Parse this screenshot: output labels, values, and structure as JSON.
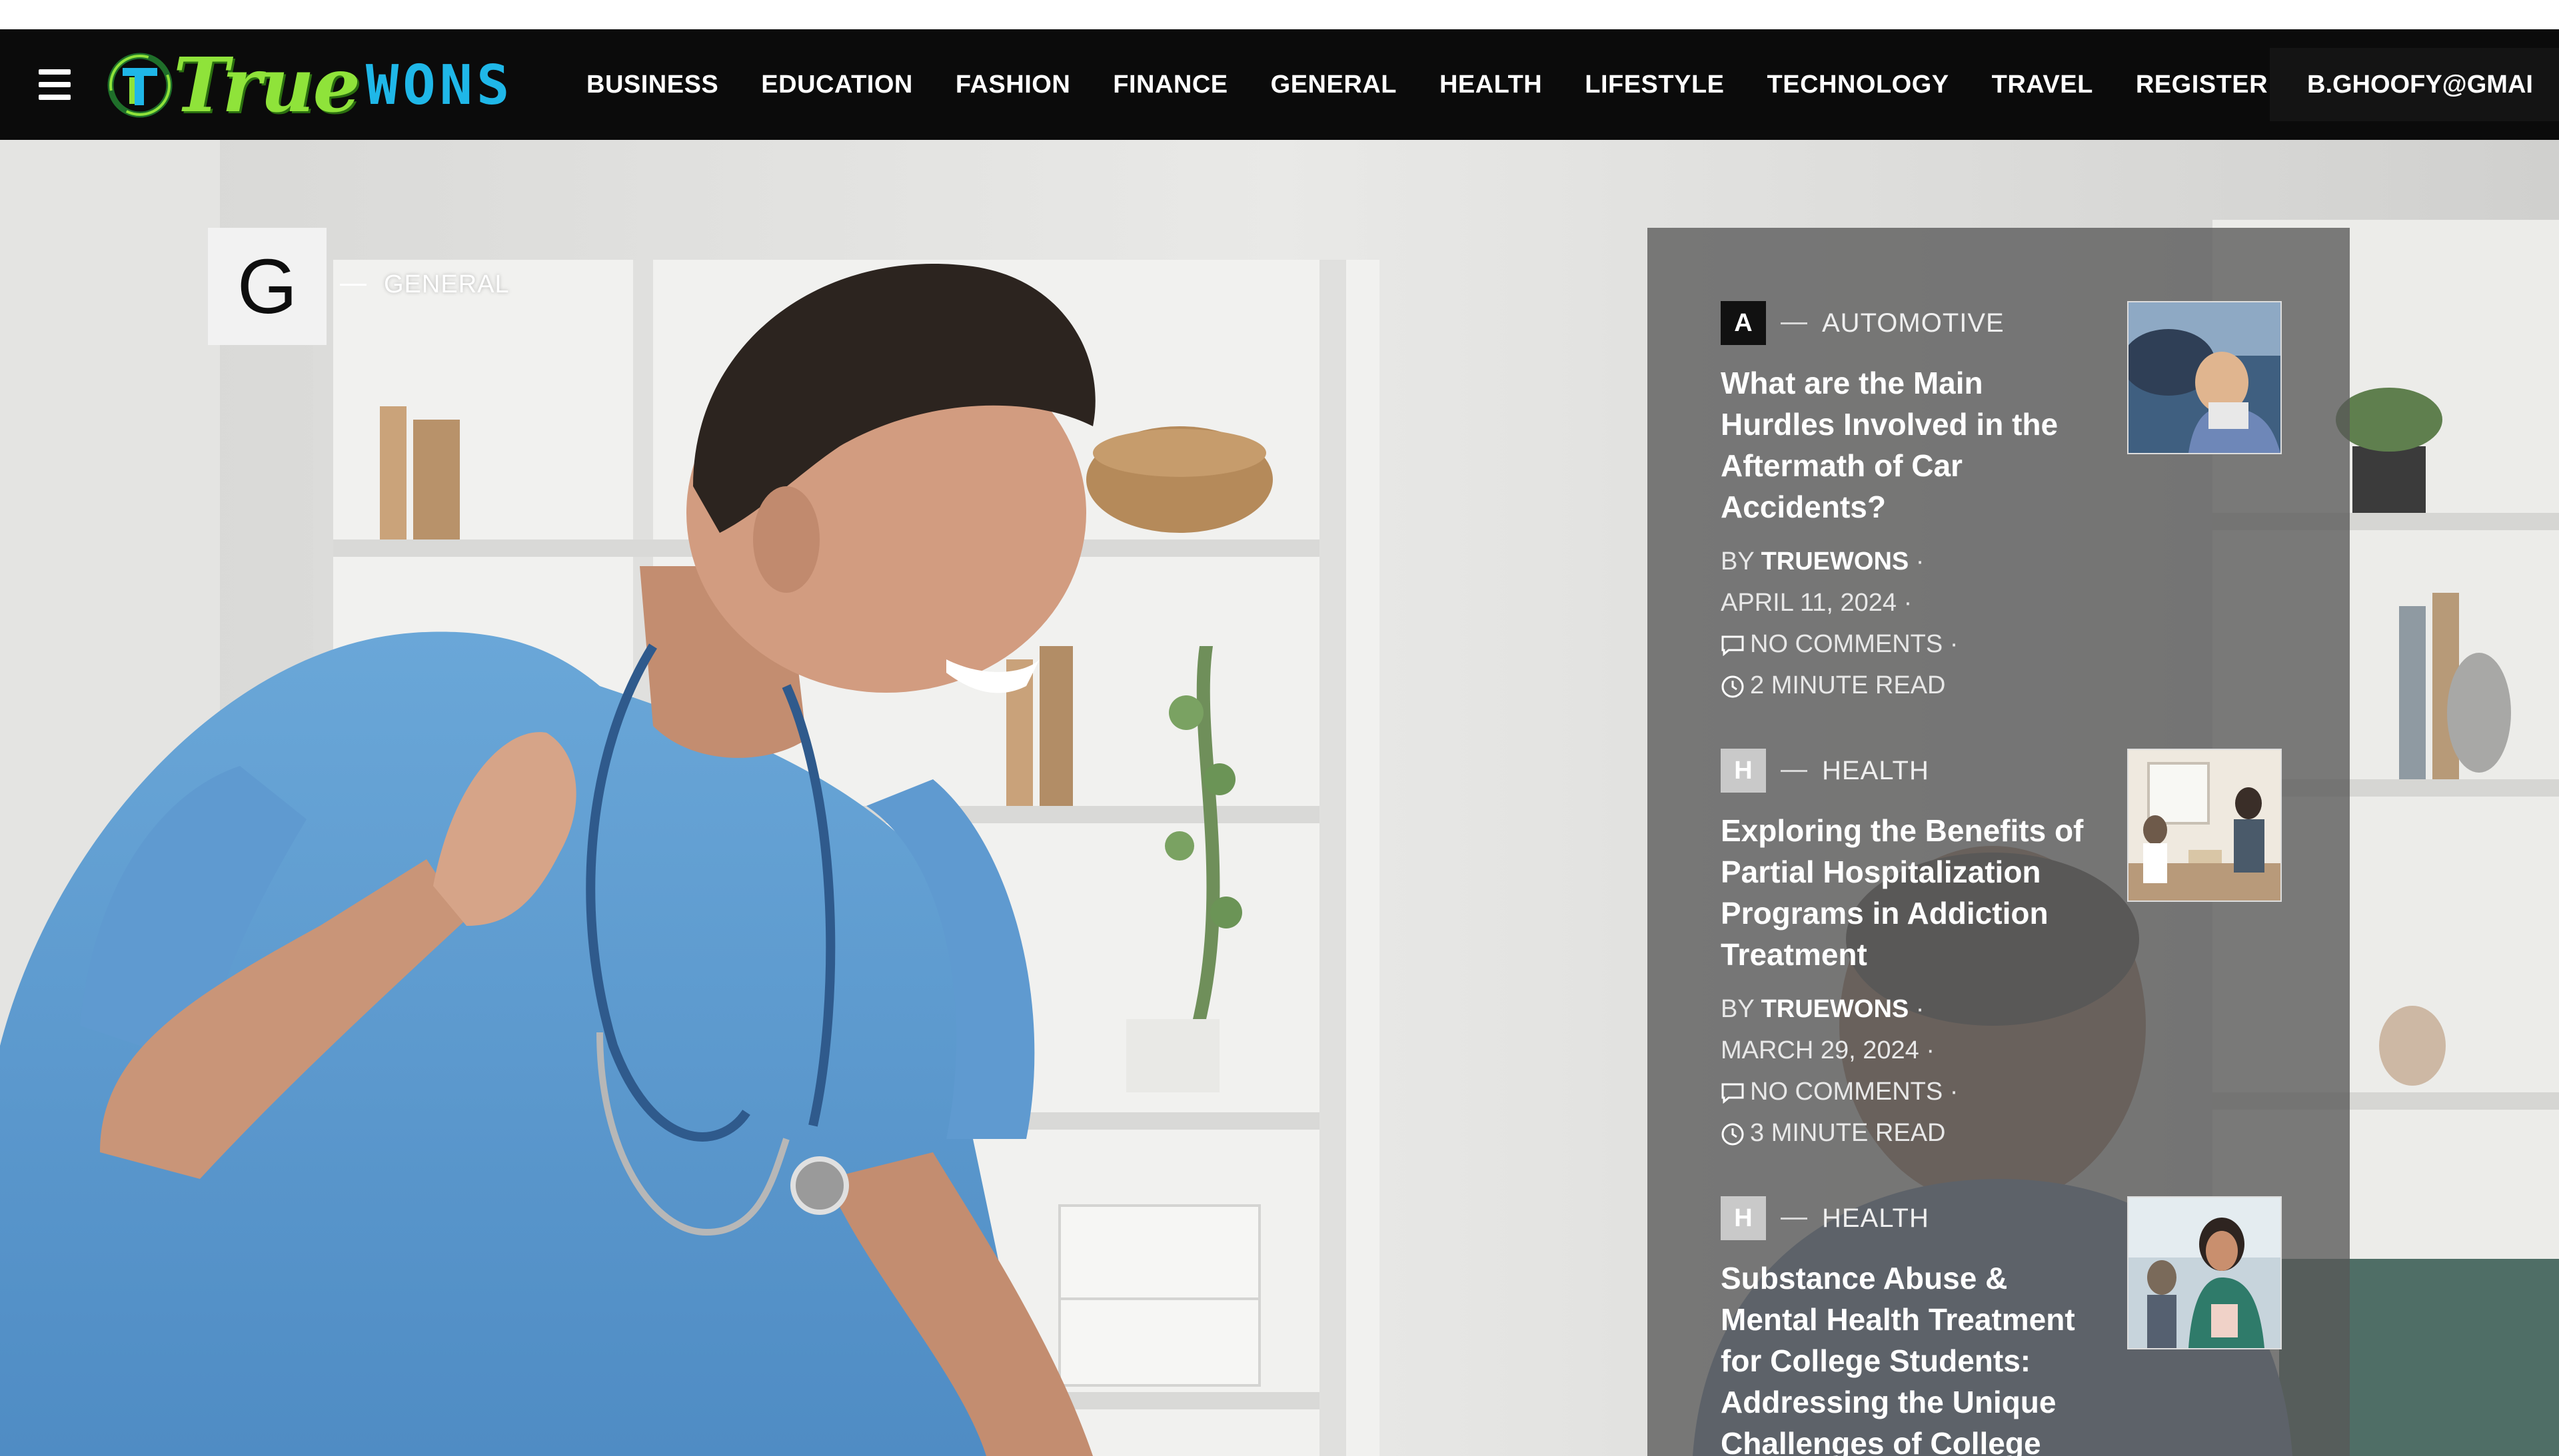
{
  "header": {
    "logo_true": "True",
    "logo_wons": "WONS",
    "nav": [
      "BUSINESS",
      "EDUCATION",
      "FASHION",
      "FINANCE",
      "GENERAL",
      "HEALTH",
      "LIFESTYLE",
      "TECHNOLOGY",
      "TRAVEL",
      "REGISTER"
    ],
    "account_email": "B.GHOOFY@GMAI",
    "icons": {
      "menu": "hamburger-menu-icon",
      "logo": "truewons-logo-icon"
    },
    "colors": {
      "background": "#0b0b0b",
      "logo_green": "#8fe33a",
      "logo_blue": "#1fb7e8"
    }
  },
  "hero": {
    "category_letter": "G",
    "category_name": "GENERAL",
    "image_icon": "nurse-waving-image"
  },
  "sidebar": {
    "posts": [
      {
        "letter": "A",
        "category": "AUTOMOTIVE",
        "title": "What are the Main Hurdles Involved in the Aftermath of Car Accidents?",
        "by_label": "BY",
        "author": "TRUEWONS",
        "date": "APRIL 11, 2024",
        "comments": "NO COMMENTS",
        "read_time": "2 MINUTE READ",
        "thumb_icon": "car-accident-thumbnail"
      },
      {
        "letter": "H",
        "category": "HEALTH",
        "title": "Exploring the Benefits of Partial Hospitalization Programs in Addiction Treatment",
        "by_label": "BY",
        "author": "TRUEWONS",
        "date": "MARCH 29, 2024",
        "comments": "NO COMMENTS",
        "read_time": "3 MINUTE READ",
        "thumb_icon": "therapy-session-thumbnail"
      },
      {
        "letter": "H",
        "category": "HEALTH",
        "title": "Substance Abuse & Mental Health Treatment for College Students: Addressing the Unique Challenges of College Life",
        "thumb_icon": "college-student-thumbnail"
      }
    ],
    "icons": {
      "comments": "comment-icon",
      "read_time": "clock-icon"
    }
  }
}
